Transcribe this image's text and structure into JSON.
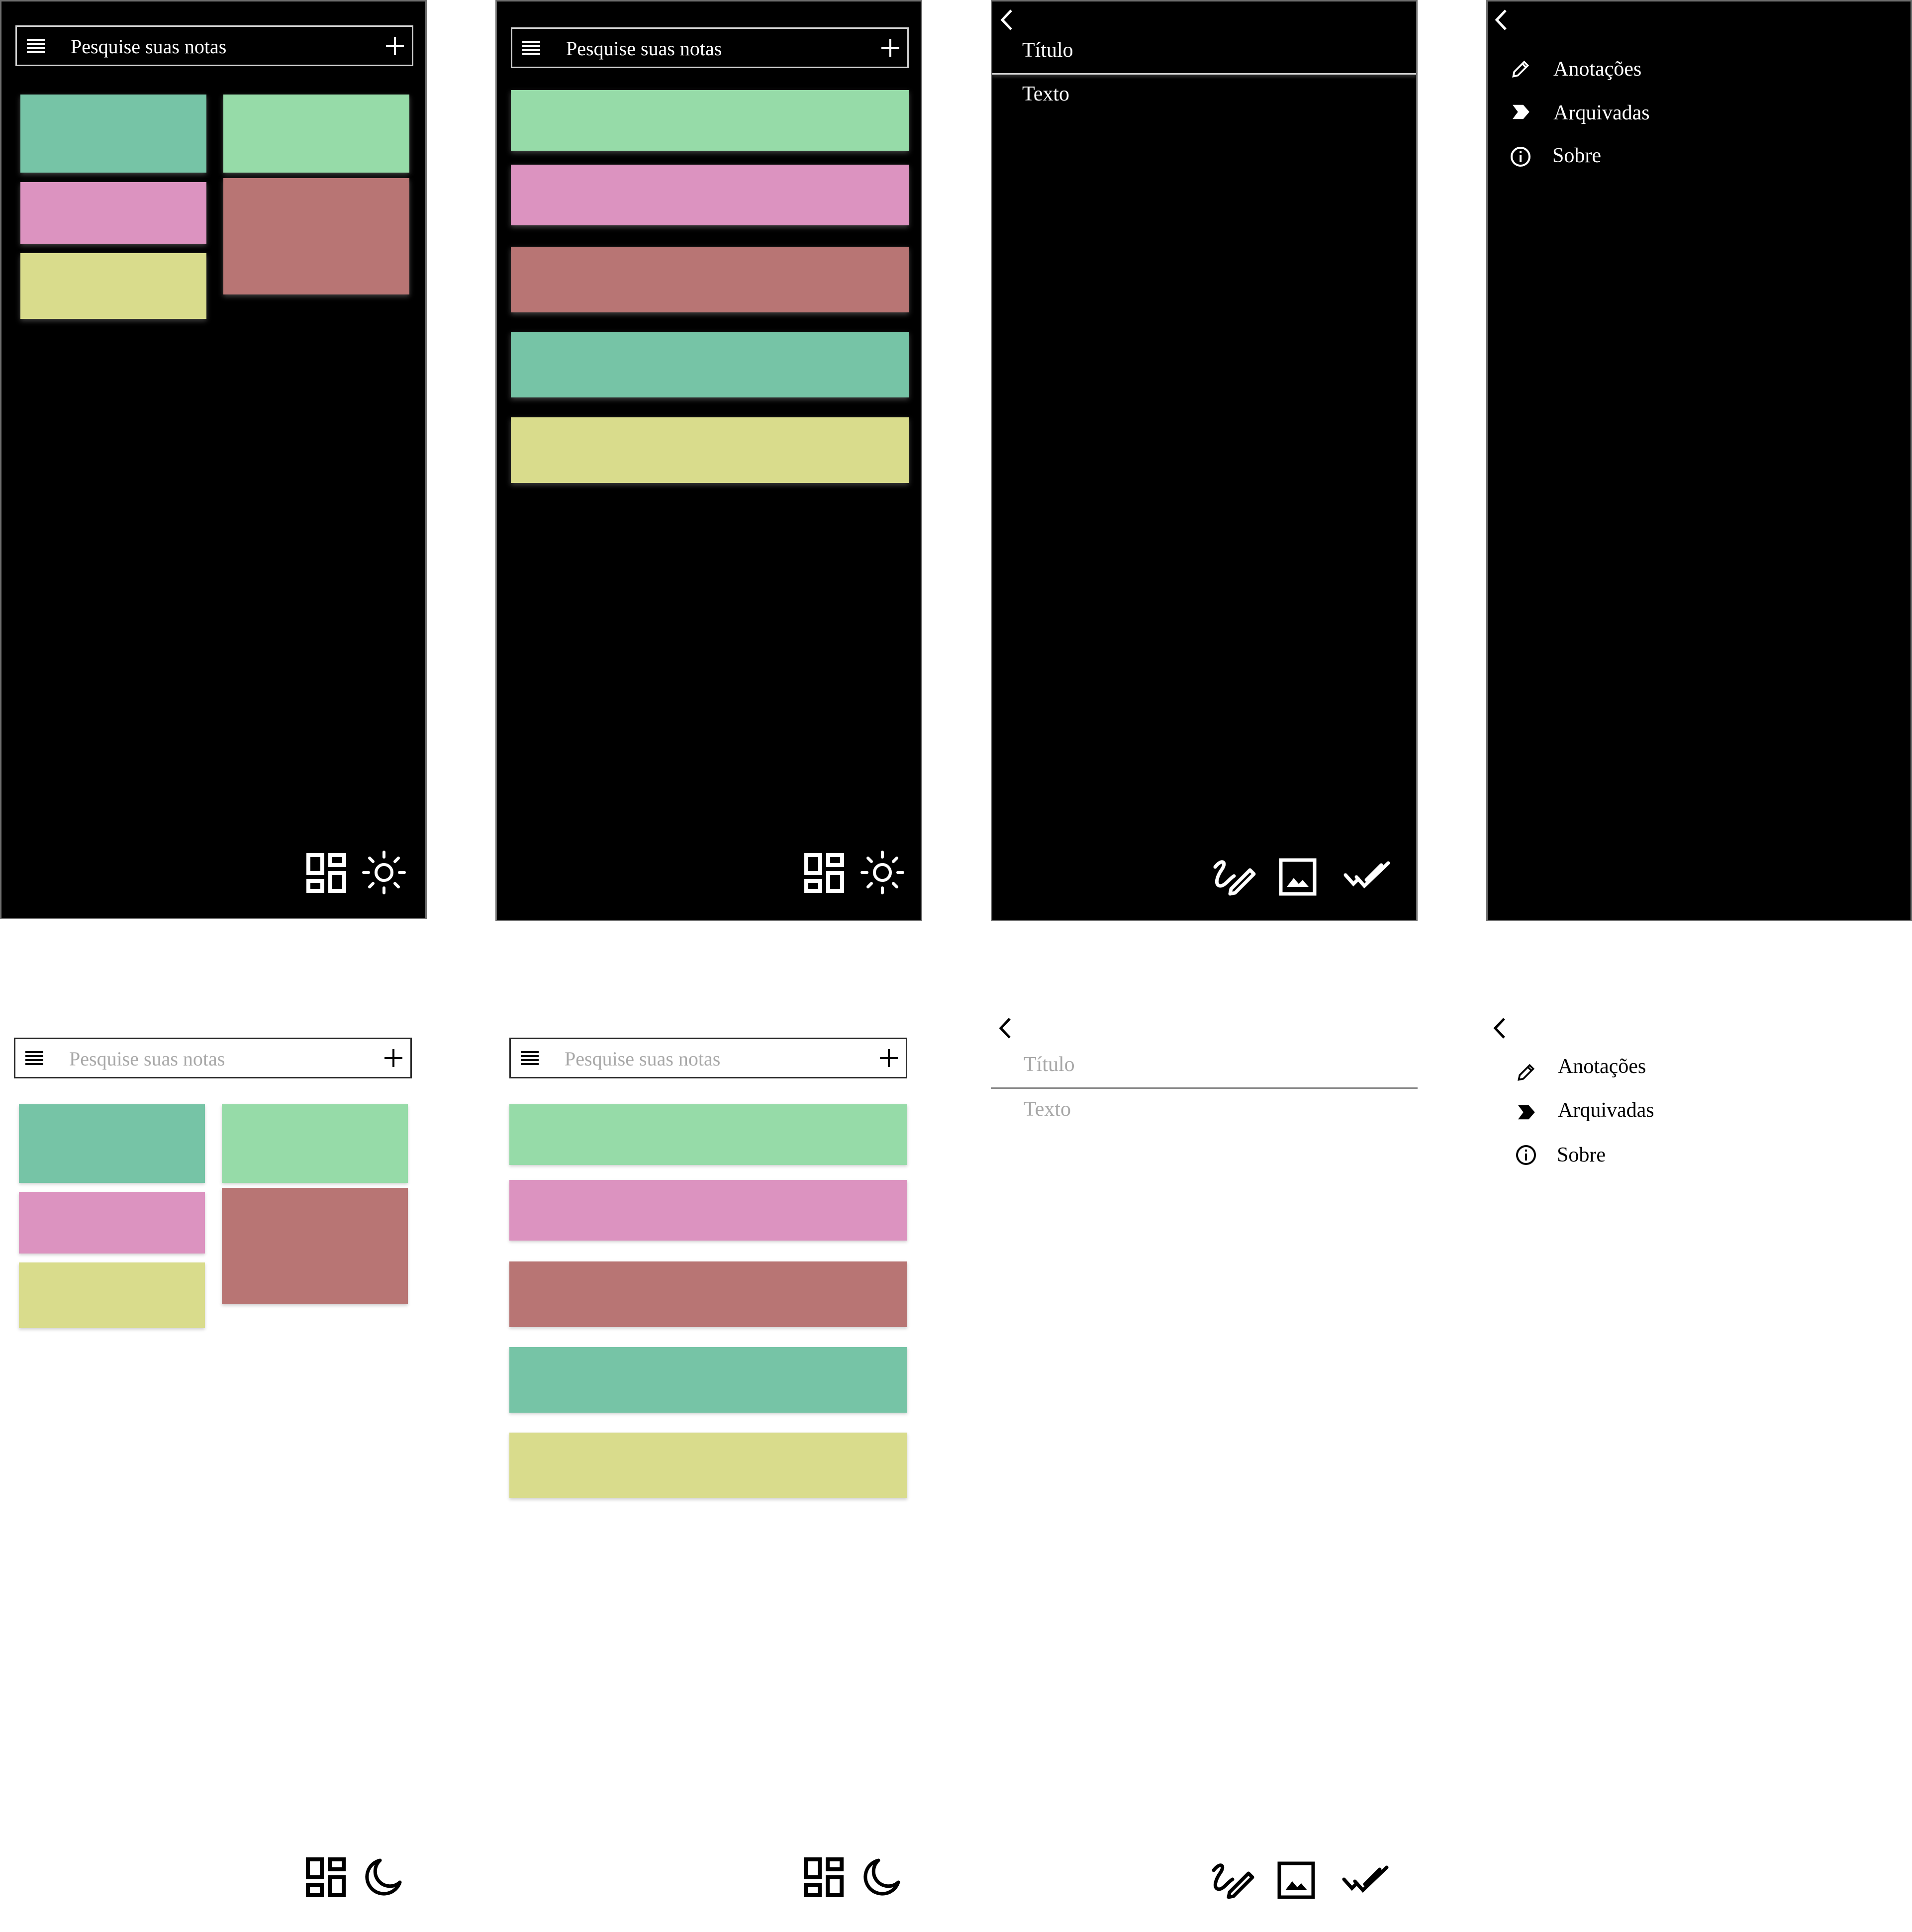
{
  "colors": {
    "teal": "#76c4a6",
    "mint": "#96dba8",
    "pink": "#dc93c0",
    "rose": "#b87574",
    "yellow": "#d9dc8c",
    "dark_bg": "#000000",
    "light_bg": "#ffffff"
  },
  "home": {
    "search_placeholder": "Pesquise suas notas",
    "grid_notes": [
      "teal",
      "mint",
      "pink",
      "rose",
      "yellow"
    ],
    "list_notes": [
      "mint",
      "pink",
      "rose",
      "teal",
      "yellow"
    ],
    "icons": {
      "menu": "menu-icon",
      "add": "plus-icon",
      "layout": "dashboard-layout-icon",
      "theme_dark_mode": "sun-icon",
      "theme_light_mode": "moon-icon"
    }
  },
  "editor": {
    "title_placeholder": "Título",
    "text_placeholder": "Texto",
    "icons": [
      "back-icon",
      "draw-icon",
      "image-icon",
      "done-all-icon"
    ]
  },
  "drawer": {
    "items": [
      {
        "label": "Anotações",
        "icon": "pencil-icon"
      },
      {
        "label": "Arquivadas",
        "icon": "label-icon"
      },
      {
        "label": "Sobre",
        "icon": "info-icon"
      }
    ]
  }
}
